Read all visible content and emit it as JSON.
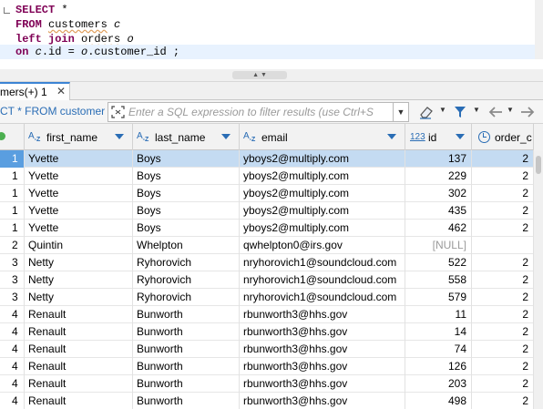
{
  "editor": {
    "lines": [
      {
        "kw": "SELECT",
        "rest": " *"
      },
      {
        "kw": "FROM",
        "table": "customers",
        "alias": "c"
      },
      {
        "kw1": "left",
        "kw2": "join",
        "table": "orders",
        "alias": "o"
      },
      {
        "kw": "on",
        "alias1": "c",
        "col1": ".id = ",
        "alias2": "o",
        "col2": ".customer_id ;"
      }
    ]
  },
  "results_tab": {
    "label": "mers(+) 1",
    "close": "✕"
  },
  "filter": {
    "query_label": "CT * FROM customer",
    "placeholder": "Enter a SQL expression to filter results (use Ctrl+S"
  },
  "columns": [
    {
      "name": "first_name",
      "type_icon": "A-Z"
    },
    {
      "name": "last_name",
      "type_icon": "A-Z"
    },
    {
      "name": "email",
      "type_icon": "A-Z"
    },
    {
      "name": "id",
      "type_icon": "123"
    },
    {
      "name": "order_c"
    }
  ],
  "rows": [
    {
      "n": "1",
      "first_name": "Yvette",
      "last_name": "Boys",
      "email": "yboys2@multiply.com",
      "id": "137",
      "order": "2",
      "selected": true
    },
    {
      "n": "1",
      "first_name": "Yvette",
      "last_name": "Boys",
      "email": "yboys2@multiply.com",
      "id": "229",
      "order": "2"
    },
    {
      "n": "1",
      "first_name": "Yvette",
      "last_name": "Boys",
      "email": "yboys2@multiply.com",
      "id": "302",
      "order": "2"
    },
    {
      "n": "1",
      "first_name": "Yvette",
      "last_name": "Boys",
      "email": "yboys2@multiply.com",
      "id": "435",
      "order": "2"
    },
    {
      "n": "1",
      "first_name": "Yvette",
      "last_name": "Boys",
      "email": "yboys2@multiply.com",
      "id": "462",
      "order": "2"
    },
    {
      "n": "2",
      "first_name": "Quintin",
      "last_name": "Whelpton",
      "email": "qwhelpton0@irs.gov",
      "id": "[NULL]",
      "order": ""
    },
    {
      "n": "3",
      "first_name": "Netty",
      "last_name": "Ryhorovich",
      "email": "nryhorovich1@soundcloud.com",
      "id": "522",
      "order": "2"
    },
    {
      "n": "3",
      "first_name": "Netty",
      "last_name": "Ryhorovich",
      "email": "nryhorovich1@soundcloud.com",
      "id": "558",
      "order": "2"
    },
    {
      "n": "3",
      "first_name": "Netty",
      "last_name": "Ryhorovich",
      "email": "nryhorovich1@soundcloud.com",
      "id": "579",
      "order": "2"
    },
    {
      "n": "4",
      "first_name": "Renault",
      "last_name": "Bunworth",
      "email": "rbunworth3@hhs.gov",
      "id": "11",
      "order": "2"
    },
    {
      "n": "4",
      "first_name": "Renault",
      "last_name": "Bunworth",
      "email": "rbunworth3@hhs.gov",
      "id": "14",
      "order": "2"
    },
    {
      "n": "4",
      "first_name": "Renault",
      "last_name": "Bunworth",
      "email": "rbunworth3@hhs.gov",
      "id": "74",
      "order": "2"
    },
    {
      "n": "4",
      "first_name": "Renault",
      "last_name": "Bunworth",
      "email": "rbunworth3@hhs.gov",
      "id": "126",
      "order": "2"
    },
    {
      "n": "4",
      "first_name": "Renault",
      "last_name": "Bunworth",
      "email": "rbunworth3@hhs.gov",
      "id": "203",
      "order": "2"
    },
    {
      "n": "4",
      "first_name": "Renault",
      "last_name": "Bunworth",
      "email": "rbunworth3@hhs.gov",
      "id": "498",
      "order": "2"
    }
  ],
  "icons": {
    "filter": "filter-icon",
    "eraser": "eraser-icon",
    "funnel": "funnel-icon",
    "back": "arrow-left-icon",
    "forward": "arrow-right-icon",
    "expand": "expand-icon"
  },
  "colors": {
    "keyword": "#7f0055",
    "selected_row": "#c4dbf2",
    "accent": "#2a6db5"
  }
}
